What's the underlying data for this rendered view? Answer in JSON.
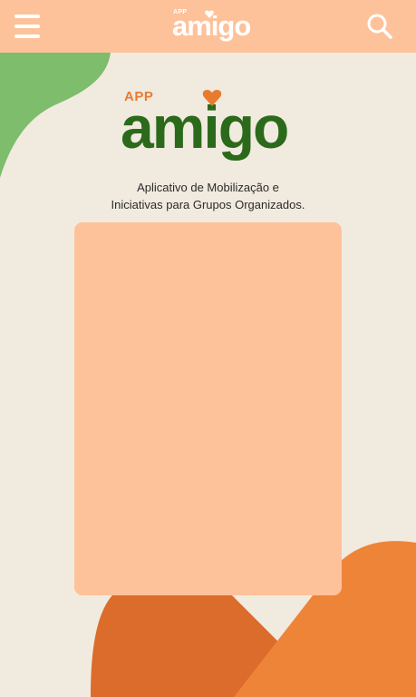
{
  "header": {
    "menu_icon": "hamburger-menu-icon",
    "search_icon": "search-icon",
    "logo_small": {
      "app": "APP",
      "word": "amigo"
    }
  },
  "logo": {
    "app": "APP",
    "word": "amigo"
  },
  "tagline": {
    "line1": "Aplicativo de Mobilização e",
    "line2": "Iniciativas para Grupos Organizados."
  },
  "colors": {
    "header_bg": "#fec29a",
    "page_bg": "#f1eadf",
    "card_bg": "#fec29a",
    "brand_green": "#2c6a1b",
    "brand_orange": "#e87b30",
    "blob_green": "#7dbd6b",
    "blob_orange": "#ee8438",
    "blob_dark_orange": "#db6c2c"
  }
}
